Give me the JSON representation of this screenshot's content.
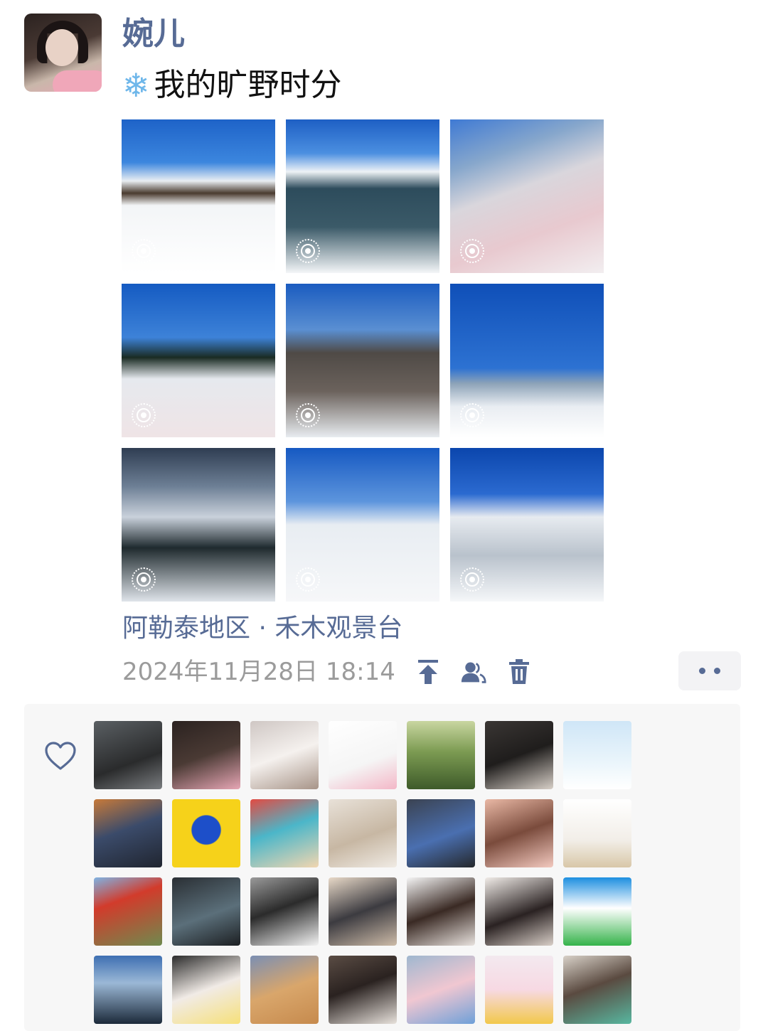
{
  "post": {
    "username": "婉儿",
    "text_icon": "snowflake-icon",
    "text": "我的旷野时分",
    "location": "阿勒泰地区 · 禾木观景台",
    "timestamp": "2024年11月28日 18:14"
  },
  "photos": [
    {
      "name": "photo-snow-cabins",
      "bg": "linear-gradient(180deg,#1e63c8 0%,#3c86de 28%,#e9eef2 40%,#4a3b2f 48%,#f3f5f7 56%,#ffffff 100%)",
      "live": true
    },
    {
      "name": "photo-river",
      "bg": "linear-gradient(180deg,#1e5fc4 0%,#4b8fe0 22%,#eef2f6 34%,#2d4c5c 45%,#3b5a68 70%,#f4f6f8 100%)",
      "live": true
    },
    {
      "name": "photo-selfie-pink",
      "bg": "linear-gradient(160deg,#3f7ad4 0%,#87a7cc 25%,#d9d6dc 45%,#e8c9cf 70%,#f2eef0 100%)",
      "live": true
    },
    {
      "name": "photo-fence-selfie",
      "bg": "linear-gradient(180deg,#155bc2 0%,#3d82d8 35%,#1a2b23 48%,#e6e9ee 62%,#efe4e6 100%)",
      "live": true
    },
    {
      "name": "photo-hemu-stone",
      "bg": "linear-gradient(180deg,#1b5cc0 0%,#5a8fd2 30%,#4f4a46 45%,#6b625c 70%,#e8ecf0 100%)",
      "live": true
    },
    {
      "name": "photo-swing",
      "bg": "linear-gradient(180deg,#0f4fb8 0%,#2d72d2 55%,#8da3b8 65%,#e9edf2 80%,#ffffff 100%)",
      "live": true
    },
    {
      "name": "photo-frosted-trees",
      "bg": "linear-gradient(180deg,#2f3d52 0%,#6d7f95 25%,#c9d1db 45%,#1f2a2e 65%,#dfe4ea 100%)",
      "live": true
    },
    {
      "name": "photo-swing-girl",
      "bg": "linear-gradient(180deg,#1659c2 0%,#5d95dd 35%,#e8edf2 50%,#f6f7f9 100%)",
      "live": true
    },
    {
      "name": "photo-snow-mountain",
      "bg": "linear-gradient(180deg,#0b46ad 0%,#2b6ad0 30%,#e7ebf0 45%,#b9c2cc 70%,#f5f7f9 100%)",
      "live": true
    }
  ],
  "likers": [
    {
      "name": "liker-avatar-1",
      "bg": "linear-gradient(160deg,#5a5f63,#2a2b2c 60%,#7a7d80)"
    },
    {
      "name": "liker-avatar-2",
      "bg": "linear-gradient(160deg,#2b2220,#4a3a34 50%,#e7a6b5)"
    },
    {
      "name": "liker-avatar-3",
      "bg": "linear-gradient(160deg,#cfc7c4,#f5f1ee 50%,#a79488)"
    },
    {
      "name": "liker-avatar-4",
      "bg": "linear-gradient(160deg,#ffffff,#f5f5f5 60%,#f3b7c7)"
    },
    {
      "name": "liker-avatar-5",
      "bg": "linear-gradient(180deg,#c9d6a1,#7c9b52 45%,#3e5b2a)"
    },
    {
      "name": "liker-avatar-6",
      "bg": "linear-gradient(160deg,#3a3634,#1f1d1c 50%,#d8d0c8)"
    },
    {
      "name": "liker-avatar-7",
      "bg": "linear-gradient(180deg,#cfe6f7,#eaf5fb 60%,#ffffff)"
    },
    {
      "name": "liker-avatar-8",
      "bg": "linear-gradient(160deg,#c77a3a,#3b4b6a 45%,#202530)"
    },
    {
      "name": "liker-avatar-9",
      "bg": "radial-gradient(circle at 50% 45%,#1d4fc9 0,#1d4fc9 28%,#f6d21a 30%)"
    },
    {
      "name": "liker-avatar-10",
      "bg": "linear-gradient(160deg,#e24b43,#4bb6c9 45%,#f2d6b0)"
    },
    {
      "name": "liker-avatar-11",
      "bg": "linear-gradient(160deg,#e8e1d8,#c7b7a3 55%,#f0ebe4)"
    },
    {
      "name": "liker-avatar-12",
      "bg": "linear-gradient(160deg,#3b4352,#4a6fb0 55%,#25282c)"
    },
    {
      "name": "liker-avatar-13",
      "bg": "linear-gradient(160deg,#e9b8a5,#7a4b3c 50%,#f3c9bf)"
    },
    {
      "name": "liker-avatar-14",
      "bg": "linear-gradient(180deg,#ffffff,#f2eee8 60%,#d8c7a8)"
    },
    {
      "name": "liker-avatar-15",
      "bg": "linear-gradient(160deg,#7fb3e3,#d23b2b 35%,#6f8a4e)"
    },
    {
      "name": "liker-avatar-16",
      "bg": "linear-gradient(160deg,#2a2f34,#5b6f7a 55%,#1c1f22)"
    },
    {
      "name": "liker-avatar-17",
      "bg": "linear-gradient(160deg,#9a9a9a,#2b2b2b 45%,#f4f4f4)"
    },
    {
      "name": "liker-avatar-18",
      "bg": "linear-gradient(160deg,#e8d9c8,#3c3b40 50%,#cdbba8)"
    },
    {
      "name": "liker-avatar-19",
      "bg": "linear-gradient(160deg,#f5f5f5,#3a2a24 50%,#e9e3df)"
    },
    {
      "name": "liker-avatar-20",
      "bg": "linear-gradient(160deg,#f1ece8,#2a2222 55%,#d9cfc8)"
    },
    {
      "name": "liker-avatar-21",
      "bg": "linear-gradient(180deg,#1d8fe0,#ffffff 45%,#35b34a)"
    },
    {
      "name": "liker-avatar-22",
      "bg": "linear-gradient(180deg,#3e6fb2,#9bb8d6 40%,#1c2a3a)"
    },
    {
      "name": "liker-avatar-23",
      "bg": "linear-gradient(160deg,#2b2b2b,#f1ebe6 50%,#f6e07a)"
    },
    {
      "name": "liker-avatar-24",
      "bg": "linear-gradient(160deg,#7b8fb3,#d9a66b 50%,#c68a4d)"
    },
    {
      "name": "liker-avatar-25",
      "bg": "linear-gradient(160deg,#5a4c44,#2a2220 45%,#e8e2dc)"
    },
    {
      "name": "liker-avatar-26",
      "bg": "linear-gradient(160deg,#9fb7cf,#f0c7d1 50%,#6fa0d8)"
    },
    {
      "name": "liker-avatar-27",
      "bg": "linear-gradient(180deg,#f3e9ef,#f7d9e3 50%,#f2c84b)"
    },
    {
      "name": "liker-avatar-28",
      "bg": "linear-gradient(160deg,#d8d1c8,#5a4a40 45%,#58b7a0)"
    }
  ]
}
